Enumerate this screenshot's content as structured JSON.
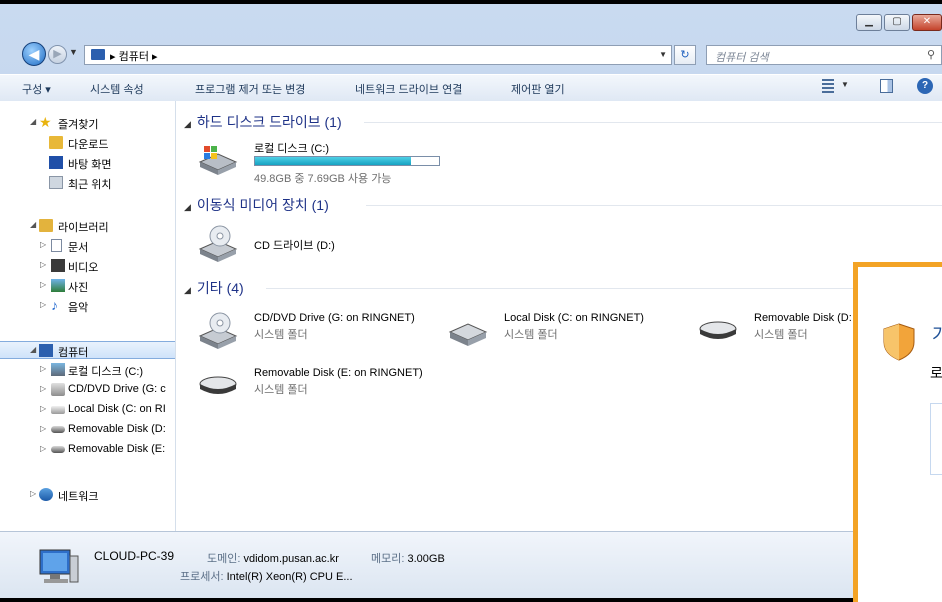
{
  "address": {
    "crumb": "컴퓨터",
    "sep": "▸"
  },
  "search": {
    "placeholder": "컴퓨터 검색"
  },
  "toolbar": {
    "organize": "구성 ▾",
    "system_props": "시스템 속성",
    "uninstall": "프로그램 제거 또는 변경",
    "map_drive": "네트워크 드라이브 연결",
    "control_panel": "제어판 열기"
  },
  "nav": {
    "favorites": "즐겨찾기",
    "downloads": "다운로드",
    "desktop": "바탕 화면",
    "recent": "최근 위치",
    "libraries": "라이브러리",
    "documents": "문서",
    "videos": "비디오",
    "pictures": "사진",
    "music": "음악",
    "computer": "컴퓨터",
    "local_c": "로컬 디스크 (C:)",
    "cd_g": "CD/DVD Drive (G: c",
    "local_c_ring": "Local Disk (C: on RI",
    "removable_d": "Removable Disk (D:",
    "removable_e": "Removable Disk (E:",
    "network": "네트워크"
  },
  "groups": {
    "hdd": "하드 디스크 드라이브 (1)",
    "removable": "이동식 미디어 장치 (1)",
    "other": "기타 (4)"
  },
  "drives": {
    "local_c": {
      "name": "로컬 디스크 (C:)",
      "free_text": "49.8GB 중 7.69GB 사용 가능",
      "used_fraction": 0.85
    },
    "cd_d": {
      "name": "CD 드라이브 (D:)"
    },
    "cd_g": {
      "name": "CD/DVD Drive (G: on RINGNET)",
      "type": "시스템 폴더"
    },
    "local_ring": {
      "name": "Local Disk (C: on RINGNET)",
      "type": "시스템 폴더"
    },
    "removable_d": {
      "name": "Removable Disk (D:",
      "type": "시스템 폴더"
    },
    "removable_e": {
      "name": "Removable Disk (E: on RINGNET)",
      "type": "시스템 폴더"
    }
  },
  "details": {
    "computer_name": "CLOUD-PC-39",
    "domain_label": "도메인:",
    "domain_value": "vdidom.pusan.ac.kr",
    "memory_label": "메모리:",
    "memory_value": "3.00GB",
    "cpu_label": "프로세서:",
    "cpu_value": "Intel(R) Xeon(R) CPU E..."
  },
  "overlay": {
    "title": "가",
    "text": "로"
  },
  "colors": {
    "accent": "#1e3287",
    "bar_fill": "#16a2c2",
    "overlay_border": "#f3a325"
  }
}
